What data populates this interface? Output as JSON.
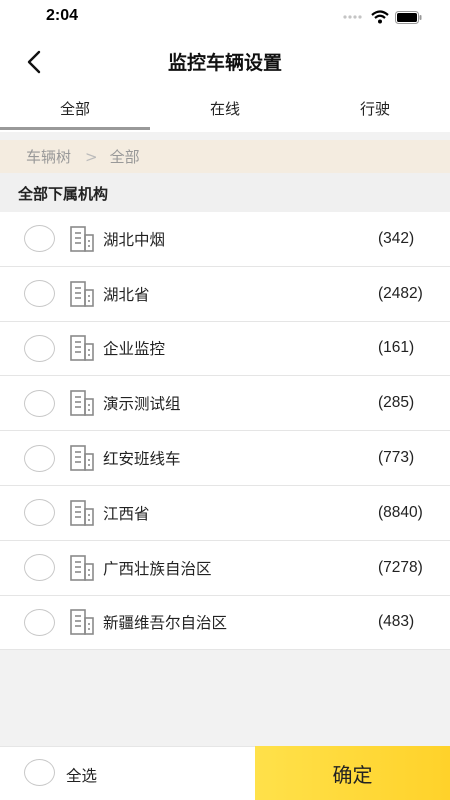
{
  "status_bar": {
    "time": "2:04"
  },
  "nav": {
    "title": "监控车辆设置"
  },
  "tabs": [
    {
      "label": "全部",
      "active": true
    },
    {
      "label": "在线",
      "active": false
    },
    {
      "label": "行驶",
      "active": false
    }
  ],
  "breadcrumb": {
    "root": "车辆树",
    "separator": ">",
    "current": "全部"
  },
  "section": {
    "title": "全部下属机构"
  },
  "organizations": [
    {
      "name": "湖北中烟",
      "count": "(342)"
    },
    {
      "name": "湖北省",
      "count": "(2482)"
    },
    {
      "name": "企业监控",
      "count": "(161)"
    },
    {
      "name": "演示测试组",
      "count": "(285)"
    },
    {
      "name": "红安班线车",
      "count": "(773)"
    },
    {
      "name": "江西省",
      "count": "(8840)"
    },
    {
      "name": "广西壮族自治区",
      "count": "(7278)"
    },
    {
      "name": "新疆维吾尔自治区",
      "count": "(483)"
    }
  ],
  "footer": {
    "select_all_label": "全选",
    "confirm_label": "确定"
  },
  "colors": {
    "accent": "#ffd22a",
    "breadcrumb_bg": "#f4ece0"
  }
}
